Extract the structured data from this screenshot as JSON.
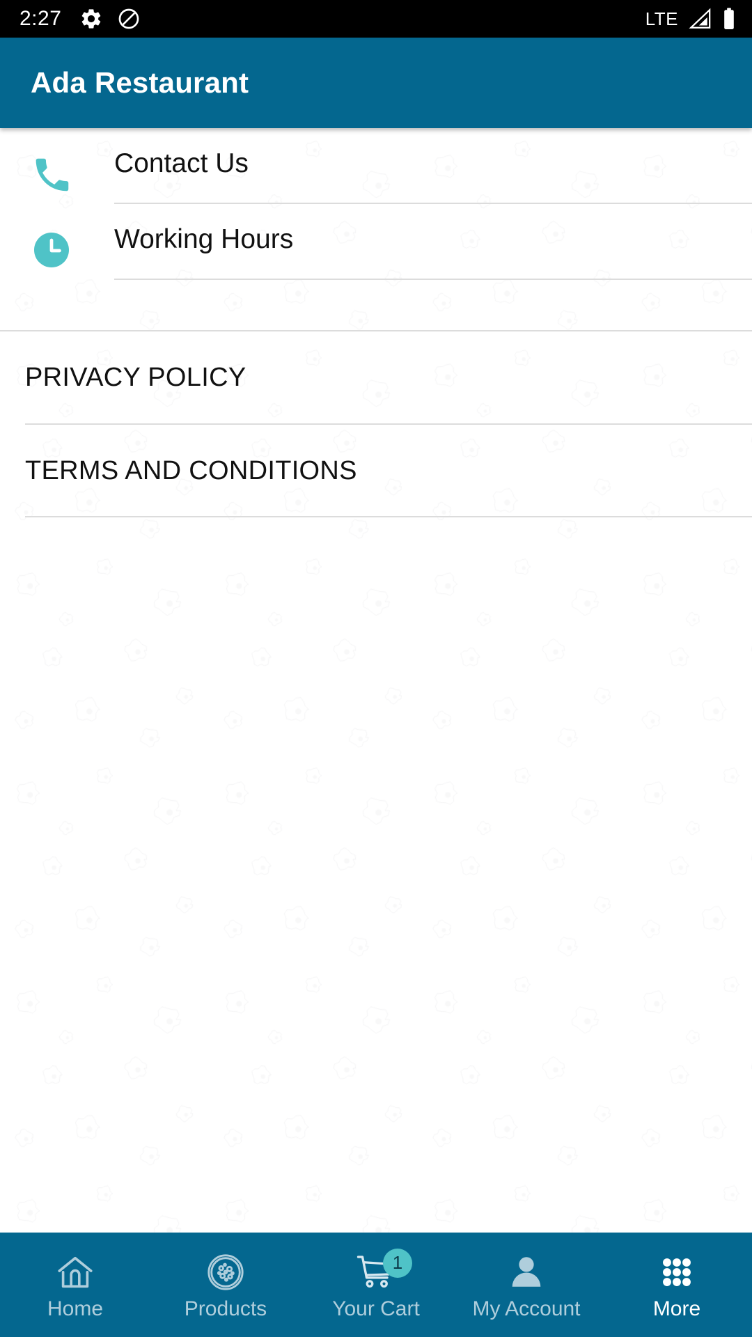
{
  "statusbar": {
    "time": "2:27",
    "icons_left": [
      "gear-icon",
      "do-not-disturb-icon"
    ],
    "network_label": "LTE",
    "icons_right": [
      "signal-icon",
      "battery-icon"
    ]
  },
  "appbar": {
    "title": "Ada Restaurant",
    "background_color": "#04678F"
  },
  "theme": {
    "primary": "#04678F",
    "accent_teal": "#4FC3C7",
    "divider": "#dcdcdc",
    "nav_inactive": "#AFCEDC",
    "nav_active": "#FFFFFF"
  },
  "main": {
    "info_items": [
      {
        "label": "Contact Us",
        "icon": "phone-icon"
      },
      {
        "label": "Working Hours",
        "icon": "clock-icon"
      }
    ],
    "legal_items": [
      {
        "label": "PRIVACY POLICY"
      },
      {
        "label": "TERMS AND CONDITIONS"
      }
    ]
  },
  "bottom_nav": {
    "items": [
      {
        "label": "Home",
        "icon": "home-icon",
        "active": false,
        "badge": null
      },
      {
        "label": "Products",
        "icon": "pizza-icon",
        "active": false,
        "badge": null
      },
      {
        "label": "Your Cart",
        "icon": "cart-icon",
        "active": false,
        "badge": "1"
      },
      {
        "label": "My Account",
        "icon": "person-icon",
        "active": false,
        "badge": null
      },
      {
        "label": "More",
        "icon": "grid-dots-icon",
        "active": true,
        "badge": null
      }
    ]
  }
}
